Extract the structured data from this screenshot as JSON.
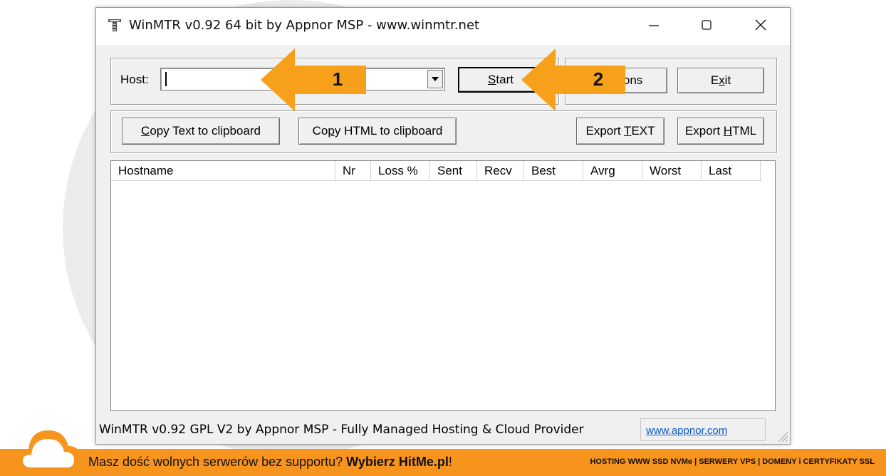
{
  "window": {
    "title": "WinMTR v0.92 64 bit by Appnor MSP - www.winmtr.net",
    "minimize_glyph": "—",
    "maximize_glyph": "☐",
    "close_glyph": "✕"
  },
  "host": {
    "label": "Host:",
    "value": "",
    "placeholder": ""
  },
  "buttons": {
    "start": {
      "pre": "",
      "acc": "S",
      "post": "tart"
    },
    "options": {
      "pre": "",
      "acc": "O",
      "post": "ptions"
    },
    "exit": {
      "pre": "E",
      "acc": "x",
      "post": "it"
    },
    "copy_text": {
      "pre": "",
      "acc": "C",
      "post": "opy Text to clipboard"
    },
    "copy_html": {
      "pre": "Co",
      "acc": "p",
      "post": "y HTML to clipboard"
    },
    "export_text": {
      "pre": "Export ",
      "acc": "T",
      "post": "EXT"
    },
    "export_html": {
      "pre": "Export ",
      "acc": "H",
      "post": "TML"
    }
  },
  "table": {
    "columns": [
      "Hostname",
      "Nr",
      "Loss %",
      "Sent",
      "Recv",
      "Best",
      "Avrg",
      "Worst",
      "Last"
    ],
    "rows": []
  },
  "status": {
    "text": "WinMTR v0.92 GPL V2 by Appnor MSP - Fully Managed Hosting & Cloud Provider",
    "link": "www.appnor.com"
  },
  "annotations": {
    "badge1": "1",
    "badge2": "2",
    "arrow_color": "#f7a01b"
  },
  "footer": {
    "text_pre": "Masz dość wolnych serwerów bez supportu? ",
    "text_bold": "Wybierz HitMe.pl",
    "text_post": "!",
    "right": "HOSTING WWW SSD NVMe | SERWERY VPS | DOMENY i CERTYFIKATY SSL",
    "color": "#f7941d"
  }
}
